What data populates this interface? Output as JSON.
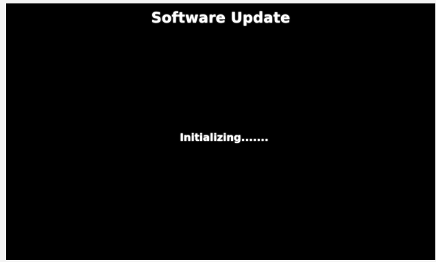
{
  "screen": {
    "title": "Software Update",
    "status": "Initializing......."
  },
  "colors": {
    "background": "#000000",
    "text": "#ffffff"
  }
}
